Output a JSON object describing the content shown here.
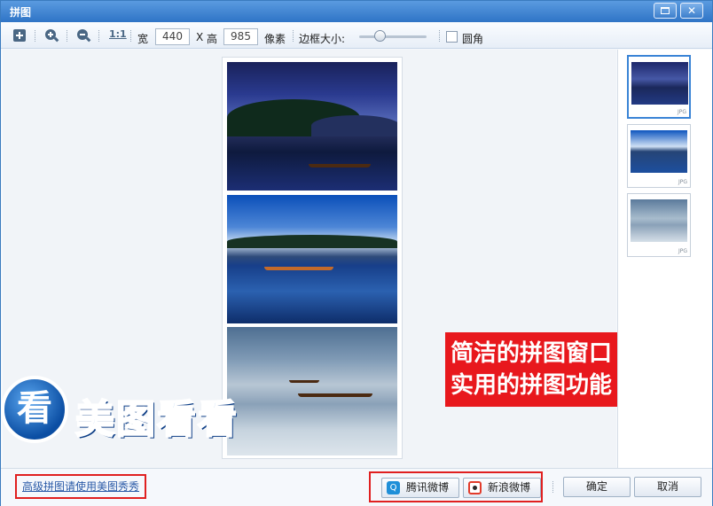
{
  "window": {
    "title": "拼图",
    "maximize_icon": "maximize-icon",
    "close_glyph": "✕"
  },
  "toolbar": {
    "width_label": "宽",
    "width_value": "440",
    "x_label": "X",
    "height_label": "高",
    "height_value": "985",
    "unit_label": "像素",
    "border_label": "边框大小:",
    "rounded_label": "圆角",
    "actual_size_label": "1:1",
    "icons": [
      "add-image-icon",
      "zoom-in-icon",
      "zoom-out-icon"
    ]
  },
  "overlay": {
    "line1": "简洁的拼图窗口",
    "line2": "实用的拼图功能",
    "color": "#e8181d"
  },
  "watermark": {
    "logo_char": "看",
    "text": "美图看看"
  },
  "thumbnails": [
    {
      "tag": "JPG",
      "selected": true
    },
    {
      "tag": "JPG",
      "selected": false
    },
    {
      "tag": "JPG",
      "selected": false
    }
  ],
  "footer": {
    "advanced_link": "高级拼图请使用美图秀秀",
    "tencent_weibo": "腾讯微博",
    "sina_weibo": "新浪微博",
    "ok": "确定",
    "cancel": "取消"
  }
}
